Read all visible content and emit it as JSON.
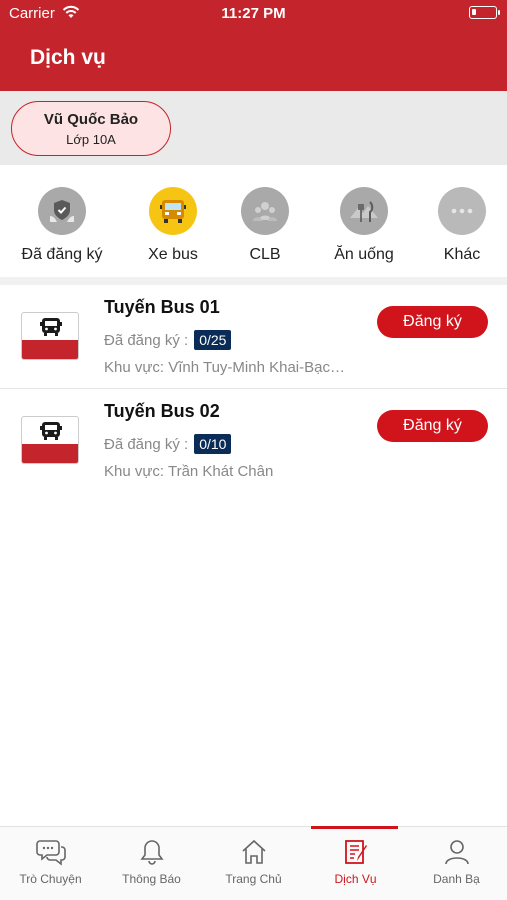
{
  "status_bar": {
    "carrier": "Carrier",
    "time": "11:27 PM"
  },
  "header": {
    "title": "Dịch vụ"
  },
  "profile": {
    "name": "Vũ Quốc Bảo",
    "class": "Lớp 10A"
  },
  "categories": [
    {
      "label": "Đã đăng ký",
      "icon": "shield-hands-icon"
    },
    {
      "label": "Xe bus",
      "icon": "school-bus-icon",
      "active": true
    },
    {
      "label": "CLB",
      "icon": "group-icon"
    },
    {
      "label": "Ăn uống",
      "icon": "fork-knife-icon"
    },
    {
      "label": "Khác",
      "icon": "more-dots-icon"
    }
  ],
  "routes": [
    {
      "name": "Tuyến Bus 01",
      "registered_label": "Đã đăng ký :",
      "count": "0/25",
      "area": "Khu vực: Vĩnh Tuy-Minh Khai-Bạc…",
      "button": "Đăng ký"
    },
    {
      "name": "Tuyến Bus 02",
      "registered_label": "Đã đăng ký :",
      "count": "0/10",
      "area": "Khu vực: Trần Khát Chân",
      "button": "Đăng ký"
    }
  ],
  "tabbar": [
    {
      "label": "Trò Chuyện",
      "icon": "chat-bubbles-icon"
    },
    {
      "label": "Thông Báo",
      "icon": "bell-icon"
    },
    {
      "label": "Trang Chủ",
      "icon": "home-icon"
    },
    {
      "label": "Dịch Vụ",
      "icon": "document-edit-icon",
      "active": true
    },
    {
      "label": "Danh Bạ",
      "icon": "person-icon"
    }
  ],
  "colors": {
    "primary": "#c4242b",
    "accent_yellow": "#f6c514",
    "badge": "#0b2c57"
  }
}
